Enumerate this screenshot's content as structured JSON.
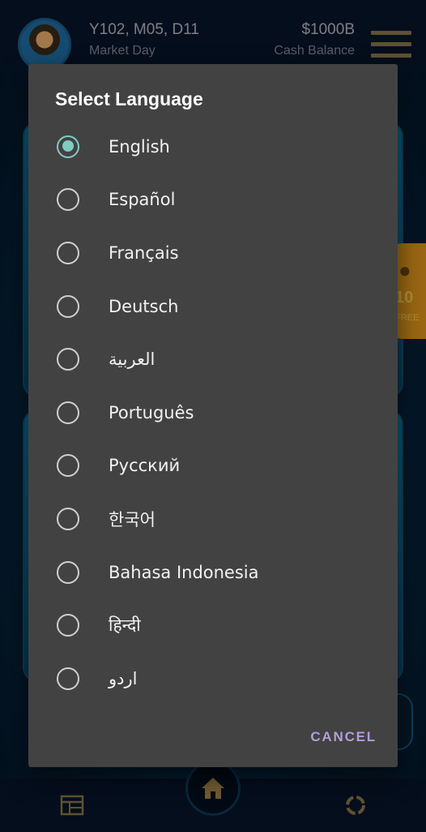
{
  "header": {
    "date": "Y102, M05, D11",
    "day_label": "Market Day",
    "cash": "$1000B",
    "cash_label": "Cash Balance"
  },
  "side_badge": {
    "amount": "10",
    "label": "FREE"
  },
  "dialog": {
    "title": "Select Language",
    "selected": "English",
    "options": [
      {
        "label": "English",
        "checked": true
      },
      {
        "label": "Español",
        "checked": false
      },
      {
        "label": "Français",
        "checked": false
      },
      {
        "label": "Deutsch",
        "checked": false
      },
      {
        "label": "العربية",
        "checked": false
      },
      {
        "label": "Português",
        "checked": false
      },
      {
        "label": "Русский",
        "checked": false
      },
      {
        "label": "한국어",
        "checked": false
      },
      {
        "label": "Bahasa Indonesia",
        "checked": false
      },
      {
        "label": "हिन्दी",
        "checked": false
      },
      {
        "label": "اردو",
        "checked": false
      }
    ],
    "cancel_label": "CANCEL"
  },
  "colors": {
    "dialog_bg": "#424242",
    "accent_radio": "#80cbc4",
    "cancel_text": "#b39ddb"
  },
  "icons": [
    "menu-icon",
    "coin-bag-icon",
    "home-icon",
    "calendar-icon",
    "refresh-ring-icon"
  ]
}
